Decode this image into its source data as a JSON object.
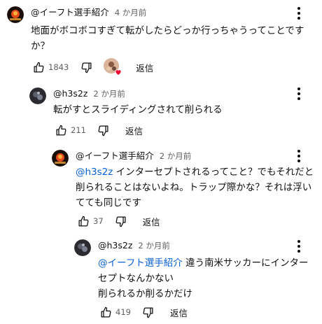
{
  "comments": [
    {
      "author": "@イーフト選手紹介",
      "time": "4 か月前",
      "text": "地面がボコボコすぎて転がしたらどっか行っちゃうってことですか？",
      "likes": "1843",
      "reply_label": "返信",
      "avatar_icon": "orange-logo-avatar",
      "has_creator_heart": true
    },
    {
      "author": "@h3s2z",
      "time": "2 か月前",
      "text": "転がすとスライディングされて削られる",
      "likes": "211",
      "reply_label": "返信",
      "avatar_icon": "dark-photo-avatar"
    },
    {
      "author": "@イーフト選手紹介",
      "time": "2 か月前",
      "mention": "@h3s2z",
      "text": "インターセプトされるってこと？でもそれだと削られることはないよね。トラップ際かな？それは浮いてても同じです",
      "likes": "37",
      "reply_label": "返信",
      "avatar_icon": "orange-logo-avatar"
    },
    {
      "author": "@h3s2z",
      "time": "2 か月前",
      "mention": "@イーフト選手紹介",
      "text_line1": "違う南米サッカーにインターセプトなんかない",
      "text_line2": "削られるか削るかだけ",
      "likes": "419",
      "reply_label": "返信",
      "avatar_icon": "dark-photo-avatar"
    }
  ],
  "colors": {
    "mention": "#065fd4",
    "heart": "#ff0033",
    "secondary_text": "#606060"
  }
}
